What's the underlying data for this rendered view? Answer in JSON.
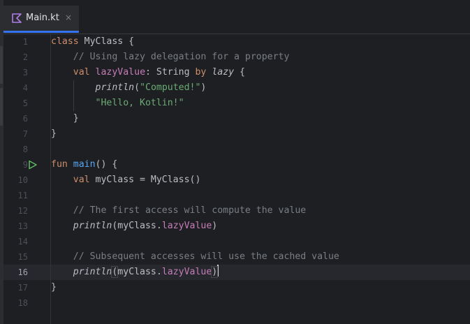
{
  "tab": {
    "label": "Main.kt",
    "close_glyph": "×",
    "icon": "kotlin-file-icon"
  },
  "editor": {
    "current_line": 16,
    "run_gutter_line": 9,
    "line_numbers": [
      "1",
      "2",
      "3",
      "4",
      "5",
      "6",
      "7",
      "8",
      "9",
      "10",
      "11",
      "12",
      "13",
      "14",
      "15",
      "16",
      "17",
      "18"
    ],
    "code": {
      "l1": {
        "kw": "class",
        "name": " MyClass {"
      },
      "l2": {
        "indent": "    ",
        "comment": "// Using lazy delegation for a property"
      },
      "l3": {
        "indent": "    ",
        "kw1": "val",
        "sp": " ",
        "prop": "lazyValue",
        "type": ": String ",
        "kw2": "by",
        "sp2": " ",
        "fn": "lazy",
        "tail": " {"
      },
      "l4": {
        "indent": "        ",
        "fn": "println",
        "open": "(",
        "str": "\"Computed!\"",
        "close": ")"
      },
      "l5": {
        "indent": "        ",
        "str": "\"Hello, Kotlin!\""
      },
      "l6": {
        "text": "    }"
      },
      "l7": {
        "text": "}"
      },
      "l9": {
        "kw": "fun",
        "sp": " ",
        "fn": "main",
        "tail": "() {"
      },
      "l10": {
        "indent": "    ",
        "kw": "val",
        "tail": " myClass = MyClass()"
      },
      "l12": {
        "indent": "    ",
        "comment": "// The first access will compute the value"
      },
      "l13": {
        "indent": "    ",
        "fn": "println",
        "open": "(myClass.",
        "prop": "lazyValue",
        "close": ")"
      },
      "l15": {
        "indent": "    ",
        "comment": "// Subsequent accesses will use the cached value"
      },
      "l16": {
        "indent": "    ",
        "fn": "println",
        "open": "(",
        "mid": "myClass.",
        "prop": "lazyValue",
        "close": ")"
      },
      "l17": {
        "text": "}"
      }
    }
  },
  "colors": {
    "background": "#1e1f22",
    "keyword": "#cf8e6d",
    "function": "#56a8f5",
    "string": "#6aab73",
    "comment": "#7a7e85",
    "property": "#c77dbb",
    "accent": "#3574f0",
    "run": "#5fb865"
  }
}
